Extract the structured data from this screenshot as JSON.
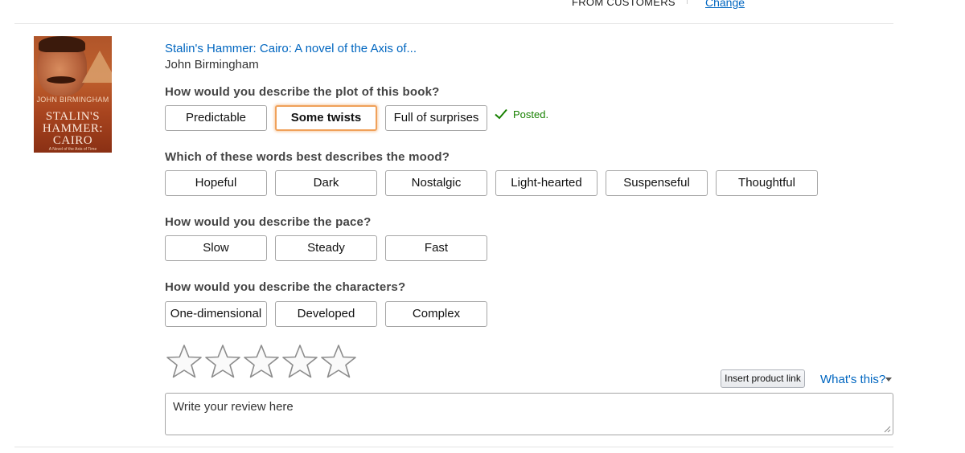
{
  "header": {
    "from_customers": "FROM CUSTOMERS",
    "change_link": "Change"
  },
  "product": {
    "title": "Stalin's Hammer: Cairo: A novel of the Axis of...",
    "author": "John Birmingham",
    "cover": {
      "author_text": "JOHN BIRMINGHAM",
      "title_line1": "STALIN'S",
      "title_line2": "HAMMER:",
      "title_line3": "CAIRO",
      "tagline": "A Novel of the Axis of Time"
    }
  },
  "questions": {
    "plot": {
      "label": "How would you describe the plot of this book?",
      "options": [
        "Predictable",
        "Some twists",
        "Full of surprises"
      ],
      "selected": "Some twists",
      "status": "Posted."
    },
    "mood": {
      "label": "Which of these words best describes the mood?",
      "options": [
        "Hopeful",
        "Dark",
        "Nostalgic",
        "Light-hearted",
        "Suspenseful",
        "Thoughtful"
      ]
    },
    "pace": {
      "label": "How would you describe the pace?",
      "options": [
        "Slow",
        "Steady",
        "Fast"
      ]
    },
    "characters": {
      "label": "How would you describe the characters?",
      "options": [
        "One-dimensional",
        "Developed",
        "Complex"
      ]
    }
  },
  "rating": {
    "max_stars": 5,
    "value": 0
  },
  "review": {
    "insert_link_label": "Insert product link",
    "whats_this": "What's this?",
    "placeholder": "Write your review here"
  },
  "colors": {
    "link": "#0066c0",
    "selected_border": "#f0a15a",
    "posted_green": "#178000"
  }
}
